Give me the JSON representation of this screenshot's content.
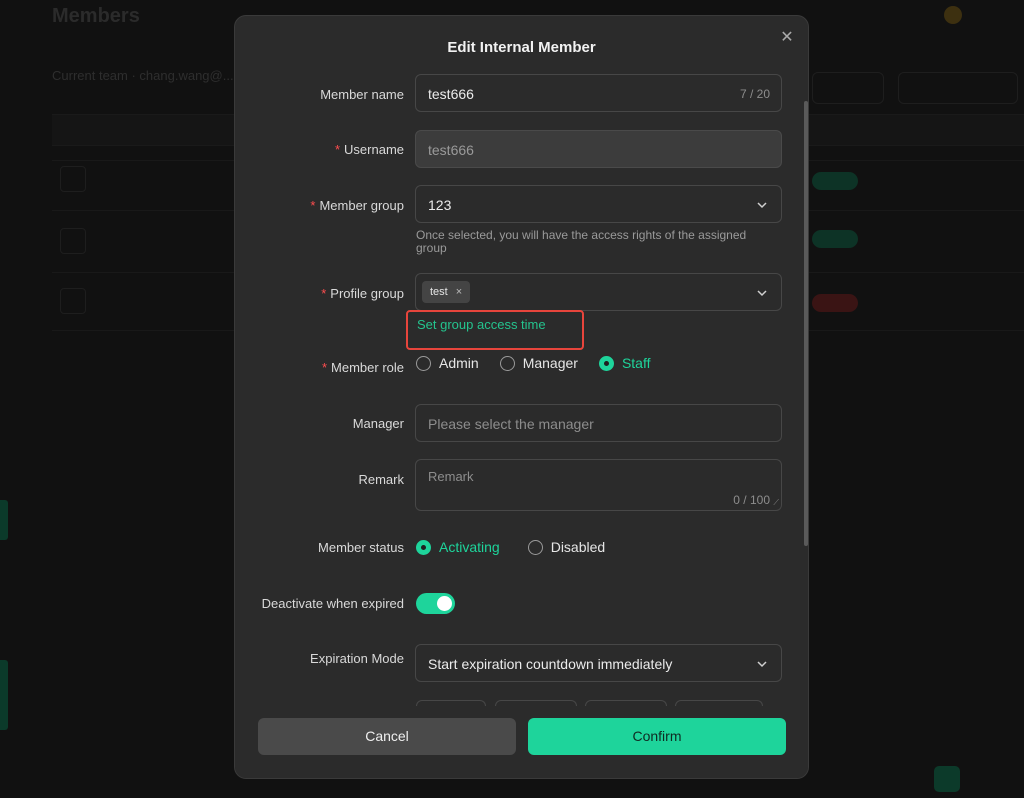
{
  "background": {
    "title": "Members",
    "subtitle": "Current team · chang.wang@..."
  },
  "modal": {
    "title": "Edit Internal Member",
    "fields": {
      "member_name": {
        "label": "Member name",
        "value": "test666",
        "count": "7 / 20"
      },
      "username": {
        "label": "Username",
        "value": "test666"
      },
      "member_group": {
        "label": "Member group",
        "value": "123",
        "hint": "Once selected, you will have the access rights of the assigned group"
      },
      "profile_group": {
        "label": "Profile group",
        "tag": "test",
        "tag_remove": "×",
        "link": "Set group access time"
      },
      "member_role": {
        "label": "Member role",
        "options": [
          "Admin",
          "Manager",
          "Staff"
        ],
        "selected": "Staff"
      },
      "manager": {
        "label": "Manager",
        "placeholder": "Please select the manager"
      },
      "remark": {
        "label": "Remark",
        "placeholder": "Remark",
        "count": "0 / 100"
      },
      "member_status": {
        "label": "Member status",
        "options": [
          "Activating",
          "Disabled"
        ],
        "selected": "Activating"
      },
      "deactivate": {
        "label": "Deactivate when expired",
        "enabled": true
      },
      "expiration_mode": {
        "label": "Expiration Mode",
        "value": "Start expiration countdown immediately"
      }
    },
    "buttons": {
      "cancel": "Cancel",
      "confirm": "Confirm"
    }
  },
  "colors": {
    "accent": "#1ed49b",
    "required": "#ff4d4f",
    "highlight": "#e8453c"
  },
  "icons": {
    "close": "close-icon",
    "dropdown": "chevron-down-icon"
  }
}
